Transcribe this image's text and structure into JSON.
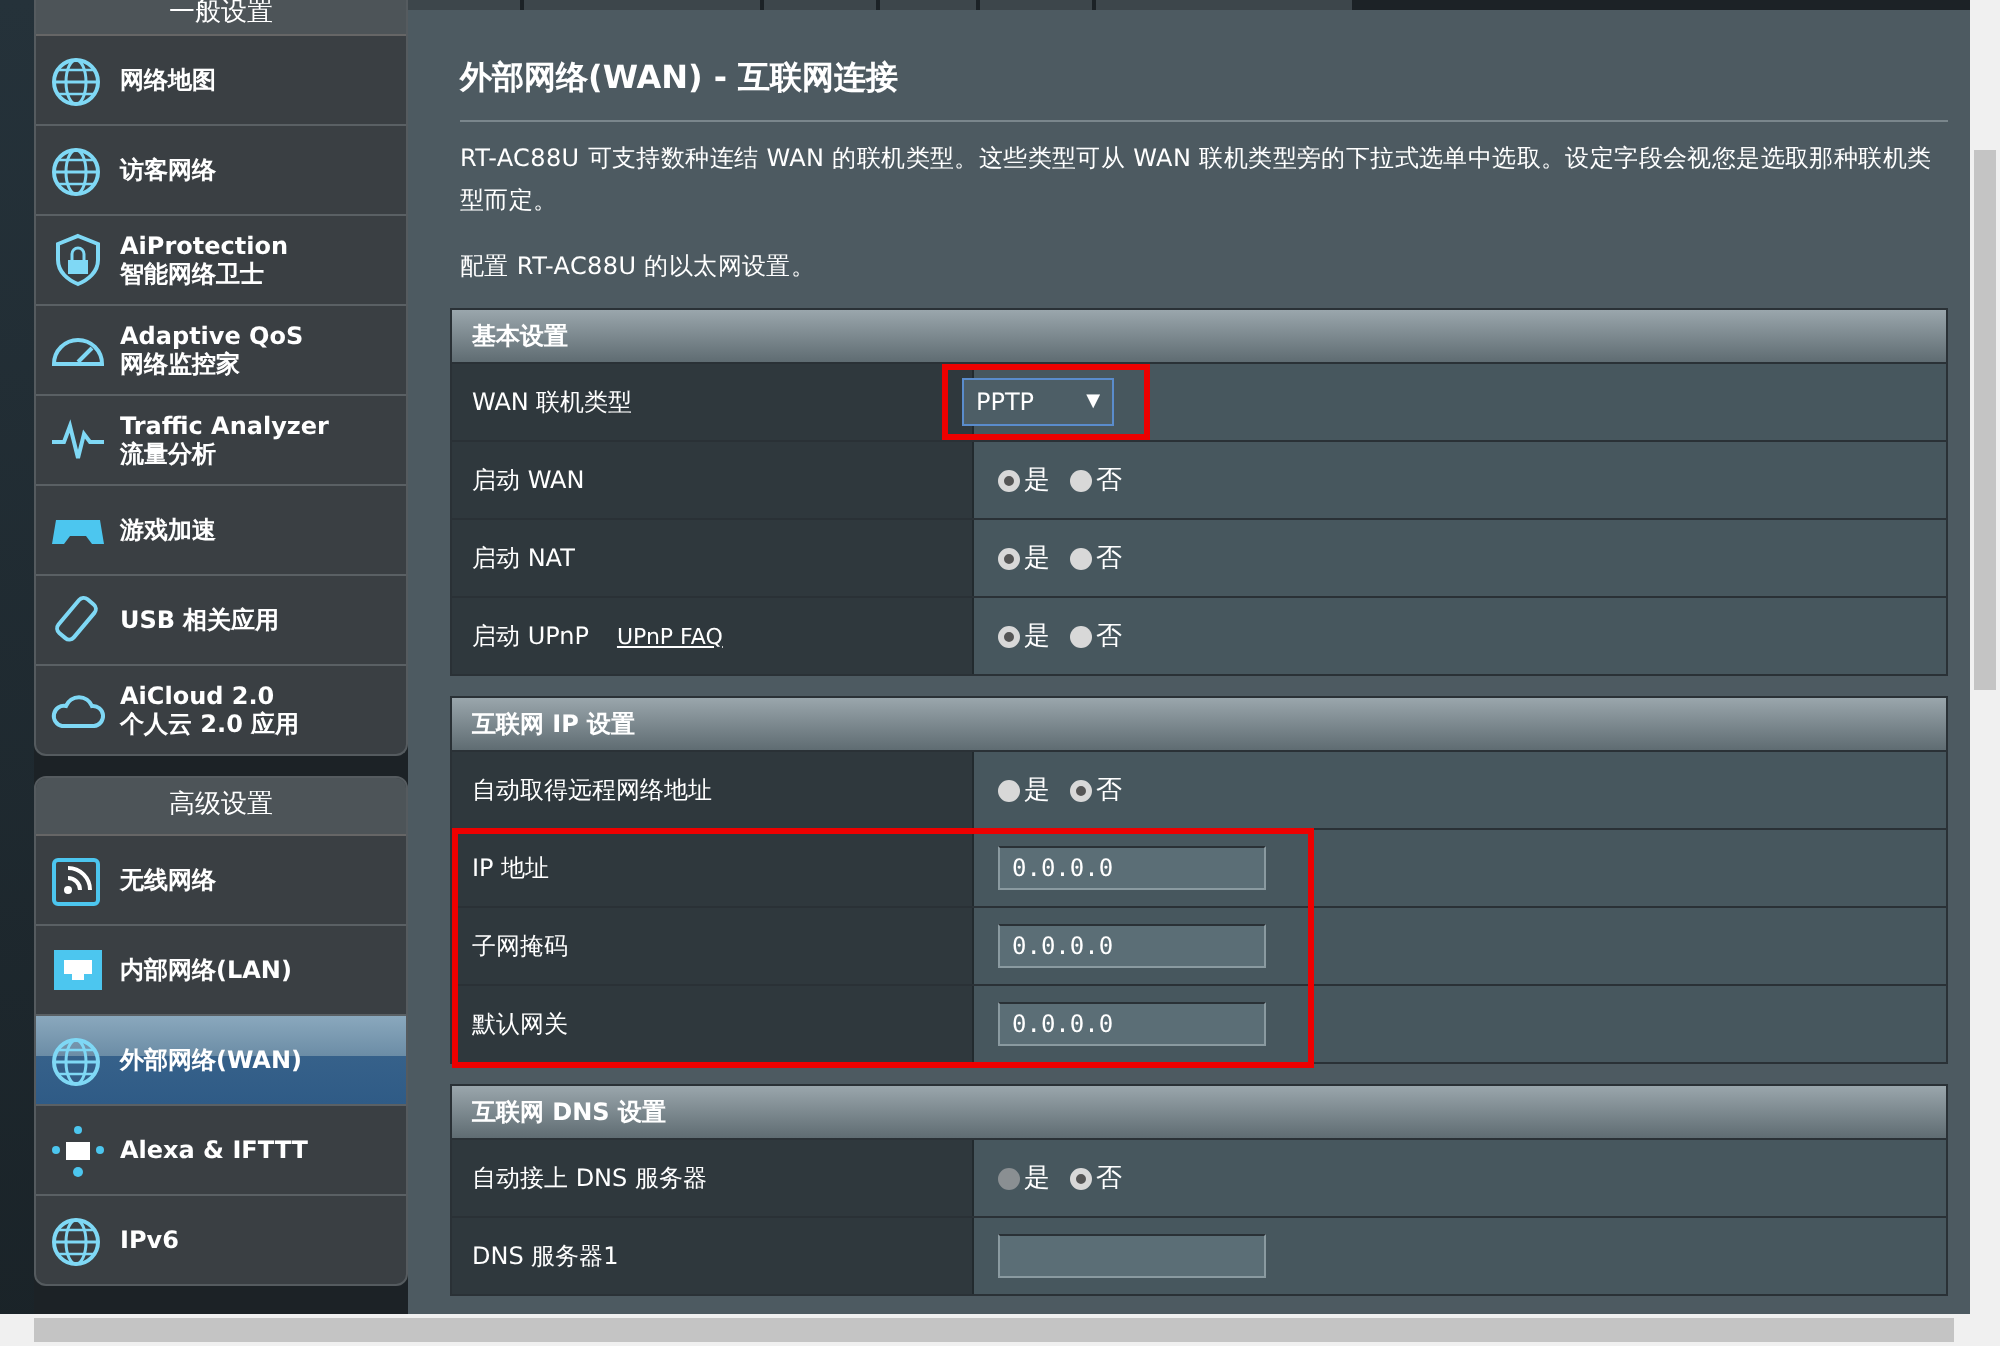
{
  "sidebar": {
    "groups": [
      {
        "title": "一般设置",
        "items": [
          {
            "label": "网络地图",
            "selected": false
          },
          {
            "label": "访客网络",
            "selected": false
          },
          {
            "label": "AiProtection\n智能网络卫士",
            "selected": false
          },
          {
            "label": "Adaptive QoS\n网络监控家",
            "selected": false
          },
          {
            "label": "Traffic Analyzer\n流量分析",
            "selected": false
          },
          {
            "label": "游戏加速",
            "selected": false
          },
          {
            "label": "USB 相关应用",
            "selected": false
          },
          {
            "label": "AiCloud 2.0\n个人云 2.0 应用",
            "selected": false
          }
        ]
      },
      {
        "title": "高级设置",
        "items": [
          {
            "label": "无线网络",
            "selected": false
          },
          {
            "label": "内部网络(LAN)",
            "selected": false
          },
          {
            "label": "外部网络(WAN)",
            "selected": true
          },
          {
            "label": "Alexa & IFTTT",
            "selected": false
          },
          {
            "label": "IPv6",
            "selected": false
          }
        ]
      }
    ]
  },
  "page": {
    "title": "外部网络(WAN) - 互联网连接",
    "description": "RT-AC88U 可支持数种连结 WAN 的联机类型。这些类型可从 WAN 联机类型旁的下拉式选单中选取。设定字段会视您是选取那种联机类型而定。",
    "note": "配置 RT-AC88U 的以太网设置。"
  },
  "sections": [
    {
      "title": "基本设置",
      "rows": [
        {
          "kind": "select",
          "label": "WAN 联机类型",
          "value": "PPTP",
          "arrow": "▼",
          "highlighted": true
        },
        {
          "kind": "radio",
          "label": "启动 WAN",
          "options": [
            {
              "label": "是",
              "selected": true,
              "disabled": false
            },
            {
              "label": "否",
              "selected": false,
              "disabled": false
            }
          ],
          "highlighted": false
        },
        {
          "kind": "radio",
          "label": "启动 NAT",
          "options": [
            {
              "label": "是",
              "selected": true,
              "disabled": false
            },
            {
              "label": "否",
              "selected": false,
              "disabled": false
            }
          ],
          "highlighted": false
        },
        {
          "kind": "radio",
          "label": "启动 UPnP",
          "link": "UPnP FAQ",
          "options": [
            {
              "label": "是",
              "selected": true,
              "disabled": false
            },
            {
              "label": "否",
              "selected": false,
              "disabled": false
            }
          ],
          "highlighted": false
        }
      ]
    },
    {
      "title": "互联网 IP 设置",
      "rows": [
        {
          "kind": "radio",
          "label": "自动取得远程网络地址",
          "options": [
            {
              "label": "是",
              "selected": false,
              "disabled": false
            },
            {
              "label": "否",
              "selected": true,
              "disabled": false
            }
          ],
          "highlighted": false
        },
        {
          "kind": "text",
          "label": "IP 地址",
          "value": "0.0.0.0",
          "highlighted": true
        },
        {
          "kind": "text",
          "label": "子网掩码",
          "value": "0.0.0.0",
          "highlighted": true
        },
        {
          "kind": "text",
          "label": "默认网关",
          "value": "0.0.0.0",
          "highlighted": true
        }
      ]
    },
    {
      "title": "互联网 DNS 设置",
      "rows": [
        {
          "kind": "radio",
          "label": "自动接上 DNS 服务器",
          "options": [
            {
              "label": "是",
              "selected": false,
              "disabled": true
            },
            {
              "label": "否",
              "selected": true,
              "disabled": false
            }
          ],
          "highlighted": false
        },
        {
          "kind": "text",
          "label": "DNS 服务器1",
          "value": "",
          "highlighted": false
        }
      ]
    }
  ]
}
